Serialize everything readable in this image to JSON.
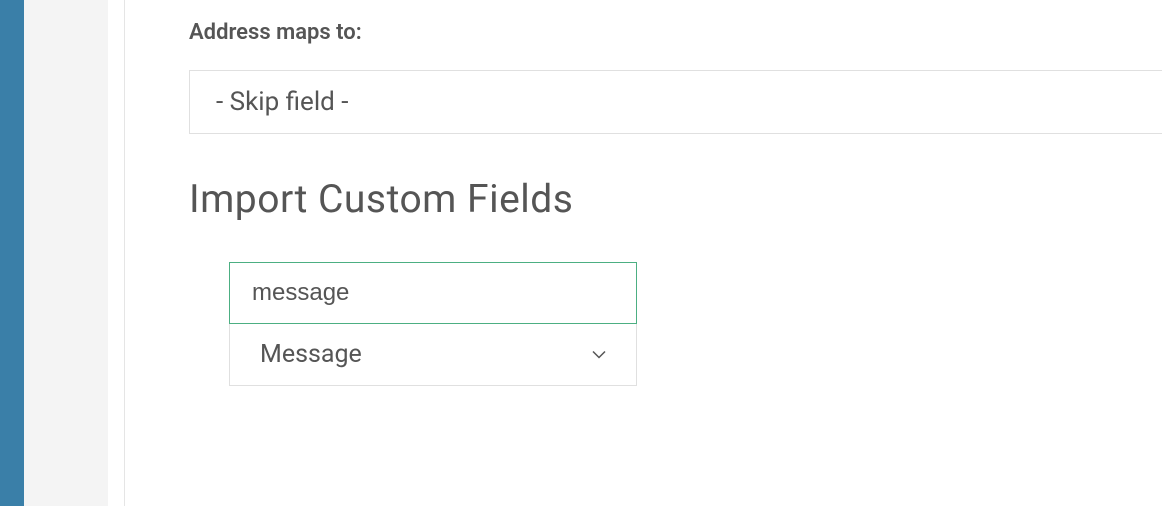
{
  "address_field": {
    "label": "Address maps to:",
    "selected": "- Skip field -"
  },
  "custom_fields": {
    "heading": "Import Custom Fields",
    "field_name_value": "message",
    "field_type_selected": "Message"
  },
  "colors": {
    "accent_blue": "#3a7fa8",
    "input_active_border": "#4caf82"
  }
}
